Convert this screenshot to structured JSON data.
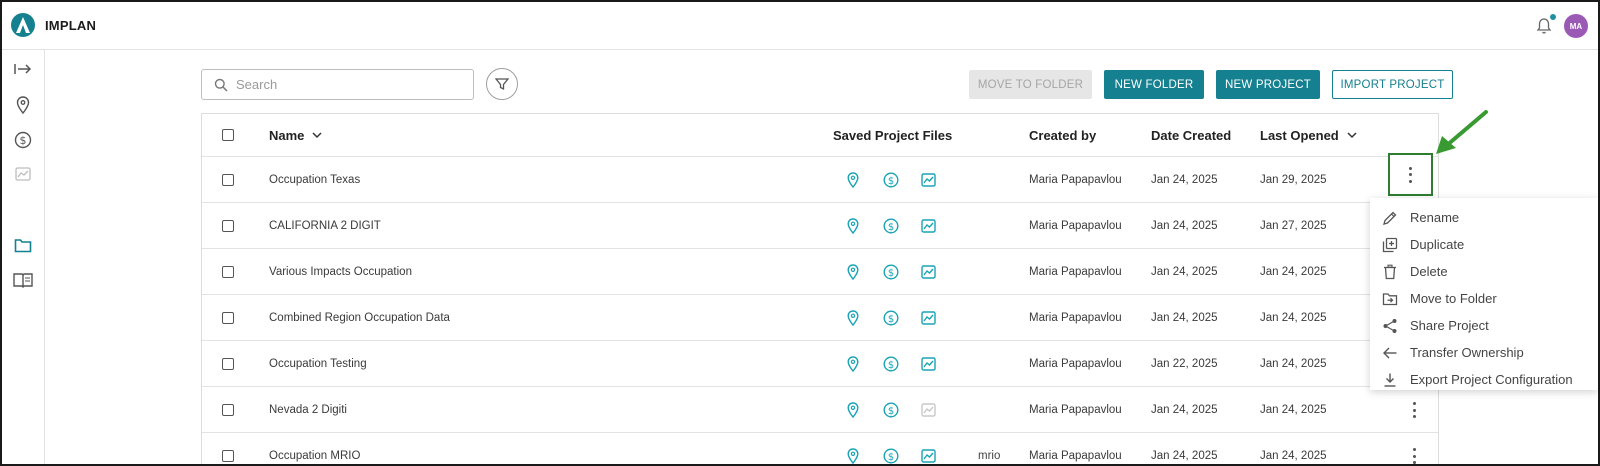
{
  "app": {
    "brand": "IMPLAN",
    "avatar_initials": "MA",
    "accent": "#15808f"
  },
  "search": {
    "placeholder": "Search",
    "value": ""
  },
  "toolbar": {
    "move_to_folder": "MOVE TO FOLDER",
    "new_folder": "NEW FOLDER",
    "new_project": "NEW PROJECT",
    "import_project": "IMPORT PROJECT"
  },
  "table": {
    "headers": {
      "name": "Name",
      "saved_files": "Saved Project Files",
      "created_by": "Created by",
      "date_created": "Date Created",
      "last_opened": "Last Opened"
    },
    "rows": [
      {
        "name": "Occupation Texas",
        "extra": "",
        "created_by": "Maria Papapavlou",
        "date_created": "Jan 24, 2025",
        "last_opened": "Jan 29, 2025",
        "chart_active": true
      },
      {
        "name": "CALIFORNIA 2 DIGIT",
        "extra": "",
        "created_by": "Maria Papapavlou",
        "date_created": "Jan 24, 2025",
        "last_opened": "Jan 27, 2025",
        "chart_active": true
      },
      {
        "name": "Various Impacts Occupation",
        "extra": "",
        "created_by": "Maria Papapavlou",
        "date_created": "Jan 24, 2025",
        "last_opened": "Jan 24, 2025",
        "chart_active": true
      },
      {
        "name": "Combined Region Occupation Data",
        "extra": "",
        "created_by": "Maria Papapavlou",
        "date_created": "Jan 24, 2025",
        "last_opened": "Jan 24, 2025",
        "chart_active": true
      },
      {
        "name": "Occupation Testing",
        "extra": "",
        "created_by": "Maria Papapavlou",
        "date_created": "Jan 22, 2025",
        "last_opened": "Jan 24, 2025",
        "chart_active": true
      },
      {
        "name": "Nevada 2 Digiti",
        "extra": "",
        "created_by": "Maria Papapavlou",
        "date_created": "Jan 24, 2025",
        "last_opened": "Jan 24, 2025",
        "chart_active": false
      },
      {
        "name": "Occupation MRIO",
        "extra": "mrio",
        "created_by": "Maria Papapavlou",
        "date_created": "Jan 24, 2025",
        "last_opened": "Jan 24, 2025",
        "chart_active": true
      }
    ]
  },
  "menu": {
    "items": [
      {
        "label": "Rename",
        "icon": "pencil-icon"
      },
      {
        "label": "Duplicate",
        "icon": "duplicate-icon"
      },
      {
        "label": "Delete",
        "icon": "trash-icon"
      },
      {
        "label": "Move to Folder",
        "icon": "folder-move-icon"
      },
      {
        "label": "Share Project",
        "icon": "share-icon"
      },
      {
        "label": "Transfer Ownership",
        "icon": "arrow-left-icon"
      },
      {
        "label": "Export Project Configuration",
        "icon": "download-icon"
      }
    ]
  },
  "colors": {
    "teal": "#1aa3b5",
    "highlight_green": "#2e7d32",
    "disabled_gray": "#c8c8c8"
  }
}
